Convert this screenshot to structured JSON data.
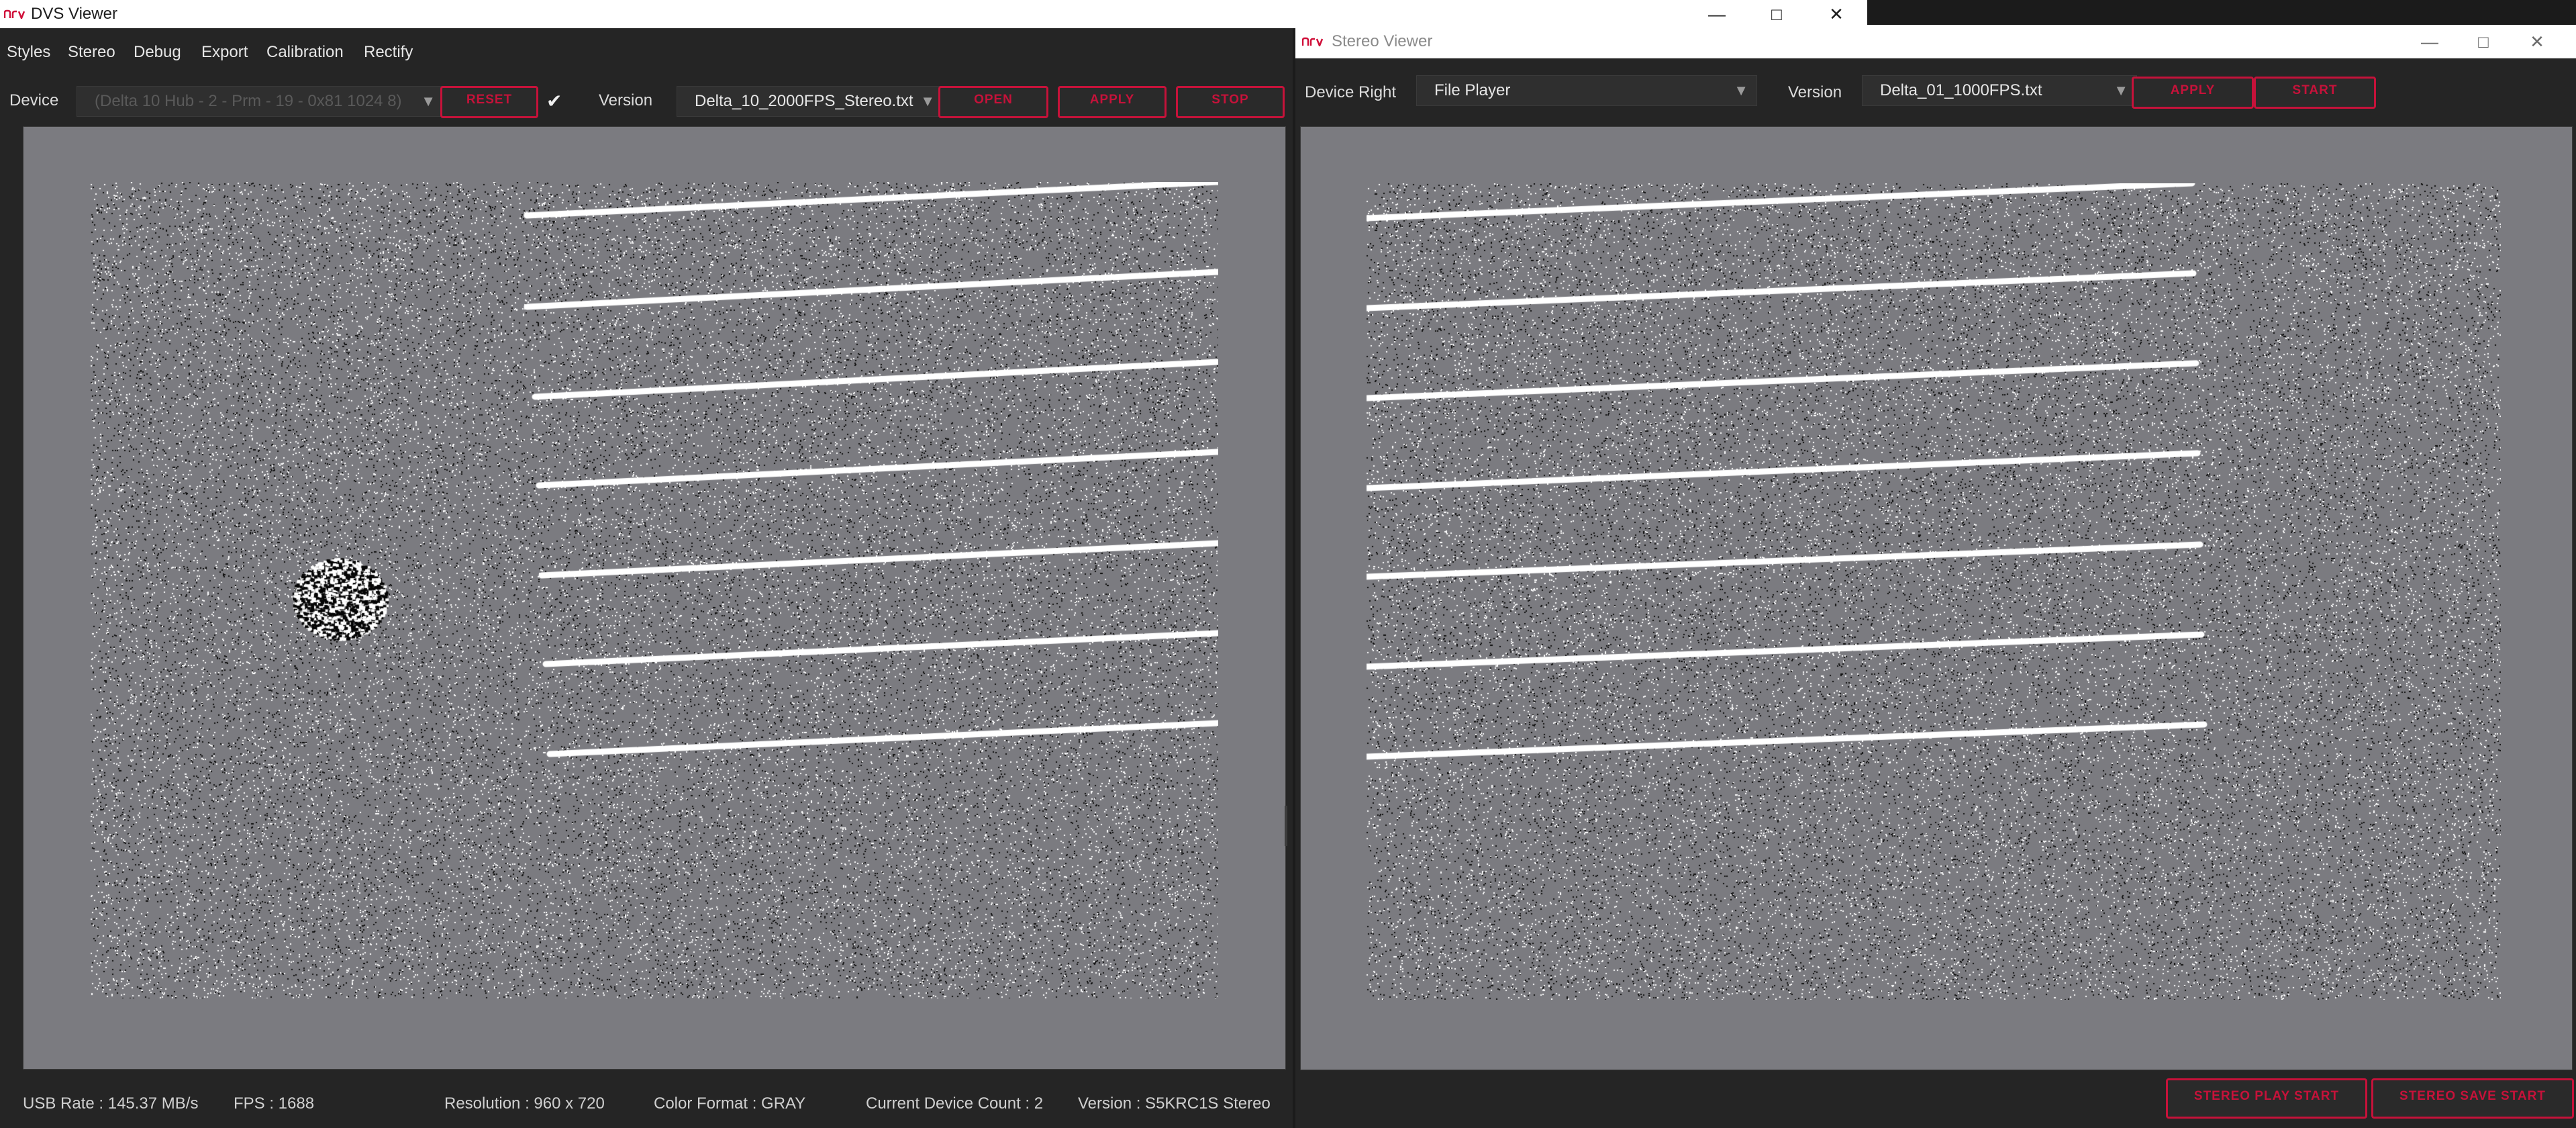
{
  "left_window": {
    "title": "DVS Viewer",
    "menu": [
      "Styles",
      "Stereo",
      "Debug",
      "Export",
      "Calibration",
      "Rectify"
    ],
    "toolbar": {
      "device_label": "Device",
      "device_value": "(Delta 10 Hub - 2 - Prm - 19 - 0x81 1024 8)",
      "reset_label": "RESET",
      "version_label": "Version",
      "version_value": "Delta_10_2000FPS_Stereo.txt",
      "open_label": "OPEN",
      "apply_label": "APPLY",
      "stop_label": "STOP"
    },
    "status": {
      "usb_rate": "USB Rate : 145.37 MB/s",
      "fps": "FPS : 1688",
      "resolution": "Resolution : 960 x 720",
      "color_format": "Color Format : GRAY",
      "device_count": "Current Device Count : 2",
      "version": "Version : S5KRC1S Stereo"
    }
  },
  "right_window": {
    "title": "Stereo Viewer",
    "toolbar": {
      "device_label": "Device Right",
      "device_value": "File Player",
      "version_label": "Version",
      "version_value": "Delta_01_1000FPS.txt",
      "apply_label": "APPLY",
      "start_label": "START"
    },
    "footer": {
      "stereo_play_start": "STEREO PLAY START",
      "stereo_save_start": "STEREO SAVE START"
    }
  },
  "colors": {
    "accent_red": "#c6123a",
    "event_background": "#7b7b80",
    "panel_dark": "#252525"
  },
  "icons": {
    "checkmark": "check-icon",
    "dropdown": "chevron-down-icon",
    "minimize": "minimize-icon",
    "maximize": "maximize-icon",
    "close": "close-icon"
  }
}
